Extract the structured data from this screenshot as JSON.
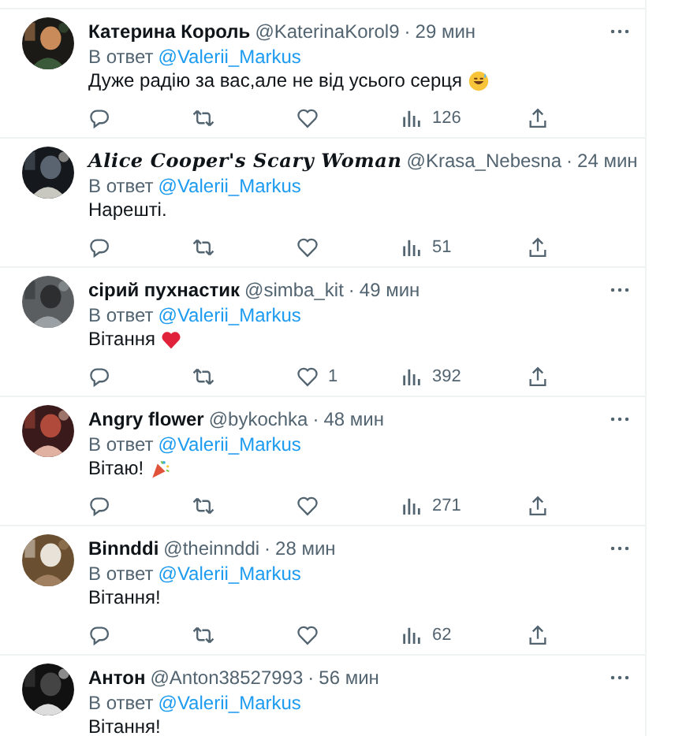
{
  "tweets": [
    {
      "name": "Катерина Король",
      "name_stylized": false,
      "handle": "@KaterinaKorol9",
      "separator": "·",
      "time": "29 мин",
      "reply_prefix": "В ответ",
      "reply_to": "@Valerii_Markus",
      "text": "Дуже радію за вас,але не від усього серця",
      "emoji": {
        "kind": "sweat-smile"
      },
      "views": "126"
    },
    {
      "name": "Alice Cooper's Scary Woman",
      "name_stylized": true,
      "handle": "@Krasa_Nebesna",
      "separator": "·",
      "time": "24 мин",
      "reply_prefix": "В ответ",
      "reply_to": "@Valerii_Markus",
      "text": "Нарешті.",
      "views": "51"
    },
    {
      "name": "сірий пухнастик",
      "name_stylized": false,
      "handle": "@simba_kit",
      "separator": "·",
      "time": "49 мин",
      "reply_prefix": "В ответ",
      "reply_to": "@Valerii_Markus",
      "text": "Вітання",
      "emoji": {
        "kind": "heart"
      },
      "likes": "1",
      "views": "392"
    },
    {
      "name": "Angry flower",
      "name_stylized": false,
      "handle": "@bykochka",
      "separator": "·",
      "time": "48 мин",
      "reply_prefix": "В ответ",
      "reply_to": "@Valerii_Markus",
      "text": "Вітаю!",
      "emoji": {
        "kind": "party"
      },
      "views": "271"
    },
    {
      "name": "Binnddi",
      "name_stylized": false,
      "handle": "@theinnddi",
      "separator": "·",
      "time": "28 мин",
      "reply_prefix": "В ответ",
      "reply_to": "@Valerii_Markus",
      "text": "Вітання!",
      "views": "62"
    },
    {
      "name": "Антон",
      "name_stylized": false,
      "handle": "@Anton38527993",
      "separator": "·",
      "time": "56 мин",
      "reply_prefix": "В ответ",
      "reply_to": "@Valerii_Markus",
      "text": "Вітання!"
    }
  ]
}
